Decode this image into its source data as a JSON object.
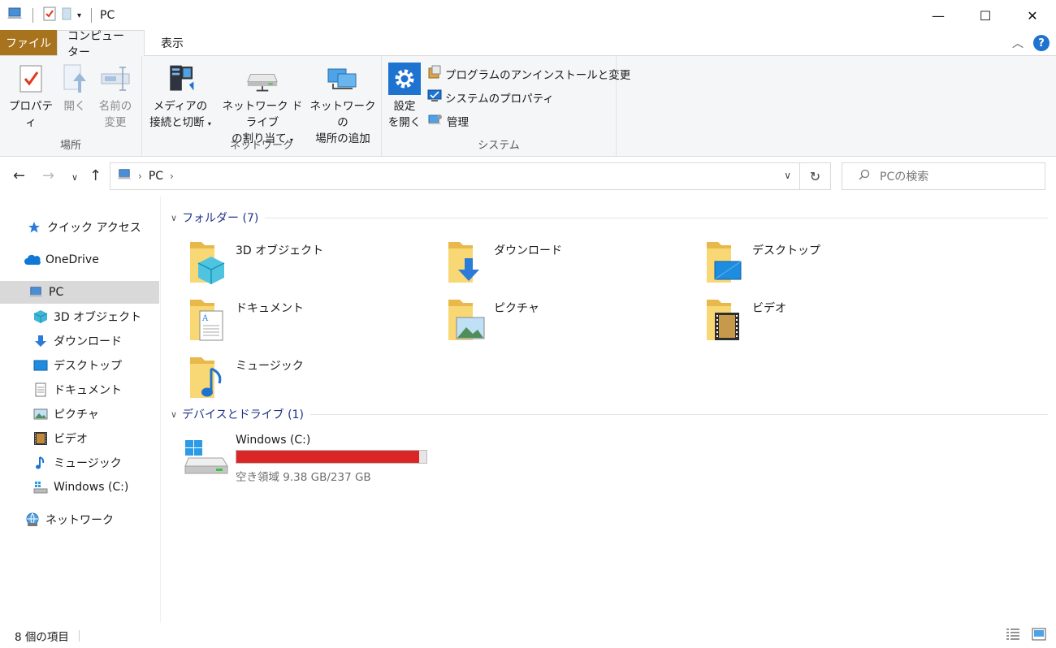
{
  "window": {
    "title": "PC"
  },
  "tabs": {
    "file": "ファイル",
    "computer": "コンピューター",
    "view": "表示"
  },
  "ribbon": {
    "location": {
      "label": "場所",
      "properties": "プロパティ",
      "open": "開く",
      "rename_line1": "名前の",
      "rename_line2": "変更"
    },
    "network": {
      "label": "ネットワーク",
      "media_line1": "メディアの",
      "media_line2": "接続と切断",
      "mapdrive_line1": "ネットワーク ドライブ",
      "mapdrive_line2": "の割り当て",
      "addloc_line1": "ネットワークの",
      "addloc_line2": "場所の追加"
    },
    "system": {
      "label": "システム",
      "settings_line1": "設定",
      "settings_line2": "を開く",
      "uninstall": "プログラムのアンインストールと変更",
      "sysprops": "システムのプロパティ",
      "manage": "管理"
    }
  },
  "address": {
    "crumb": "PC"
  },
  "search": {
    "placeholder": "PCの検索"
  },
  "nav": {
    "quick_access": "クイック アクセス",
    "onedrive": "OneDrive",
    "pc": "PC",
    "objects3d": "3D オブジェクト",
    "downloads": "ダウンロード",
    "desktop": "デスクトップ",
    "documents": "ドキュメント",
    "pictures": "ピクチャ",
    "videos": "ビデオ",
    "music": "ミュージック",
    "cdrive": "Windows (C:)",
    "network": "ネットワーク"
  },
  "content": {
    "folders_header": "フォルダー (7)",
    "folders": {
      "objects3d": "3D オブジェクト",
      "downloads": "ダウンロード",
      "desktop": "デスクトップ",
      "documents": "ドキュメント",
      "pictures": "ピクチャ",
      "videos": "ビデオ",
      "music": "ミュージック"
    },
    "devices_header": "デバイスとドライブ (1)",
    "drive": {
      "name": "Windows (C:)",
      "free_text": "空き領域 9.38 GB/237 GB",
      "used_fraction": 0.96
    }
  },
  "status": {
    "count": "8 個の項目"
  },
  "colors": {
    "file_tab": "#a8731d",
    "drive_bar": "#da2626",
    "accent": "#1e73d1"
  }
}
